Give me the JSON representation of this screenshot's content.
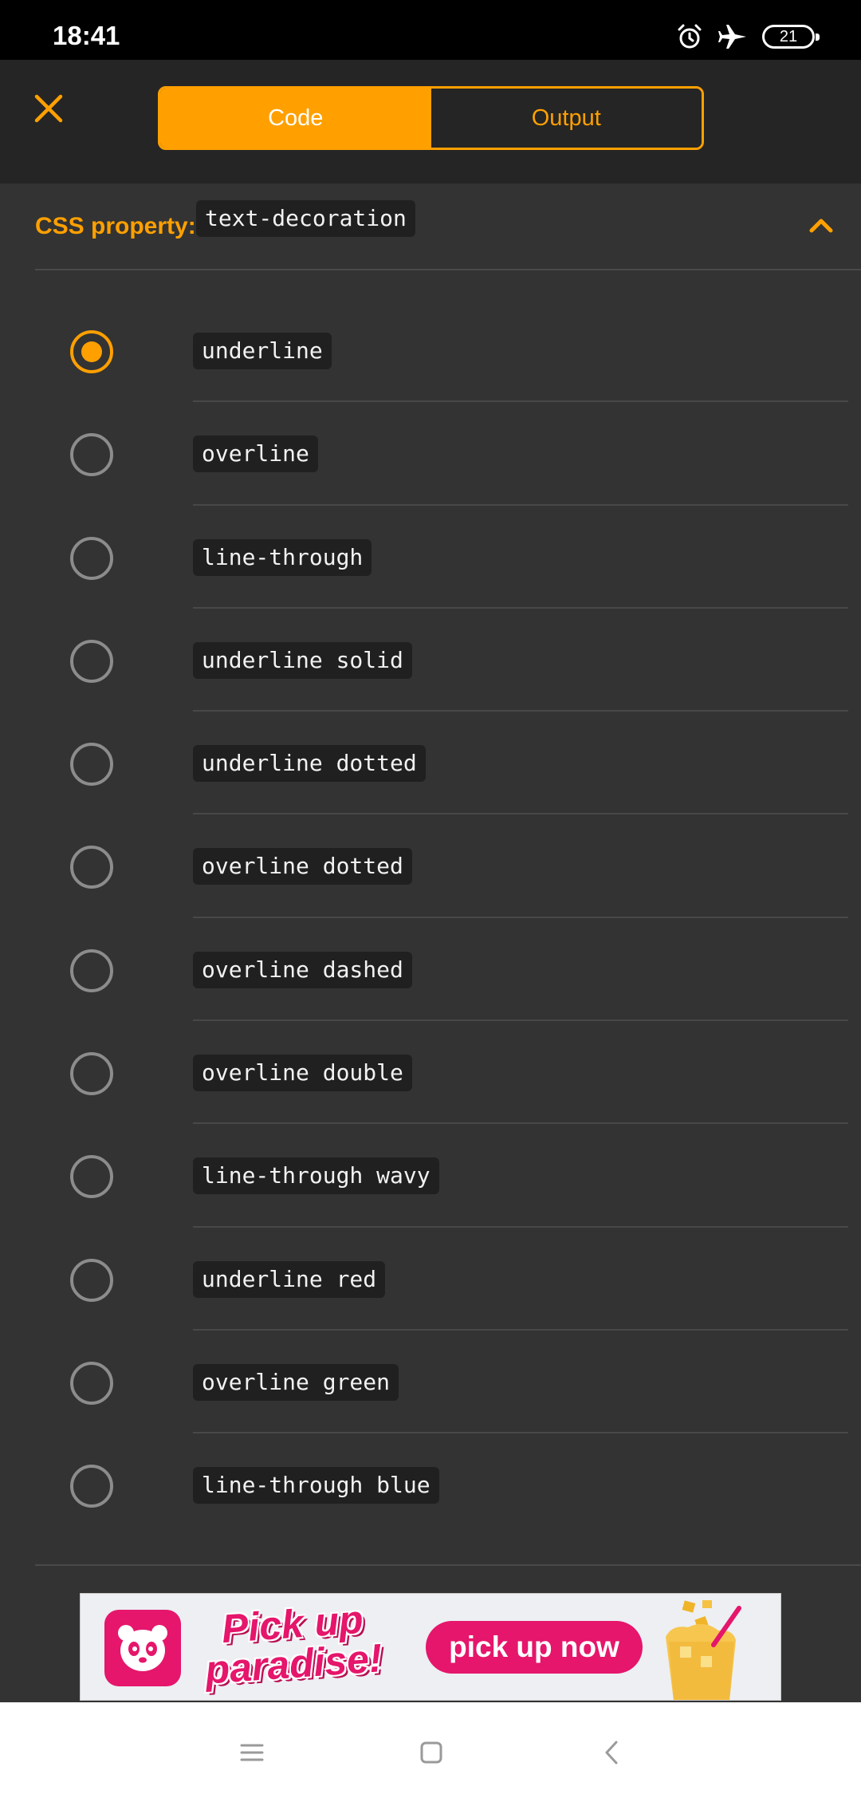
{
  "status_bar": {
    "time": "18:41",
    "icons": [
      "alarm-icon",
      "airplane-mode-icon",
      "battery-icon"
    ],
    "battery_level": "21"
  },
  "toolbar": {
    "close_icon": "close-icon",
    "tabs": [
      {
        "label": "Code",
        "active": true
      },
      {
        "label": "Output",
        "active": false
      }
    ]
  },
  "property": {
    "label": "CSS property:",
    "name": "text-decoration",
    "expanded": true,
    "toggle_icon": "chevron-up-icon"
  },
  "options": [
    {
      "value": "underline",
      "selected": true
    },
    {
      "value": "overline",
      "selected": false
    },
    {
      "value": "line-through",
      "selected": false
    },
    {
      "value": "underline solid",
      "selected": false
    },
    {
      "value": "underline dotted",
      "selected": false
    },
    {
      "value": "overline dotted",
      "selected": false
    },
    {
      "value": "overline dashed",
      "selected": false
    },
    {
      "value": "overline double",
      "selected": false
    },
    {
      "value": "line-through wavy",
      "selected": false
    },
    {
      "value": "underline red",
      "selected": false
    },
    {
      "value": "overline green",
      "selected": false
    },
    {
      "value": "line-through blue",
      "selected": false
    }
  ],
  "ad": {
    "headline_line1": "Pick up",
    "headline_line2": "paradise!",
    "cta": "pick up now",
    "logo_icon": "panda-logo-icon",
    "image_icon": "drink-icon"
  },
  "nav": {
    "icons": [
      "menu-icon",
      "home-square-icon",
      "back-icon"
    ]
  },
  "colors": {
    "accent": "#ffa000",
    "background": "#333333",
    "toolbar": "#252525",
    "ad_brand": "#e5166b"
  }
}
